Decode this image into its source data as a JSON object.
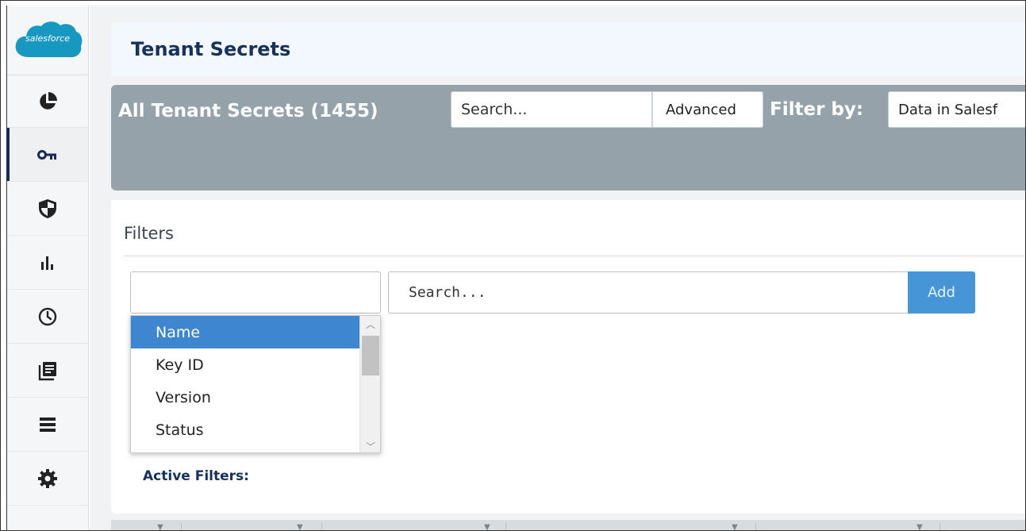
{
  "brand": {
    "logo_text": "salesforce",
    "logo_color": "#1798c1"
  },
  "sidebar": {
    "items": [
      {
        "icon": "pie-chart-icon",
        "active": false
      },
      {
        "icon": "key-icon",
        "active": true
      },
      {
        "icon": "shield-icon",
        "active": false
      },
      {
        "icon": "bar-chart-icon",
        "active": false
      },
      {
        "icon": "clock-icon",
        "active": false
      },
      {
        "icon": "document-list-icon",
        "active": false
      },
      {
        "icon": "server-list-icon",
        "active": false
      },
      {
        "icon": "gear-icon",
        "active": false
      }
    ]
  },
  "header": {
    "title": "Tenant Secrets"
  },
  "toolbar": {
    "title": "All Tenant Secrets (1455)",
    "search_placeholder": "Search...",
    "advanced_label": "Advanced",
    "filter_label": "Filter by:",
    "filter_value": "Data in Salesf"
  },
  "filters": {
    "heading": "Filters",
    "search_placeholder": "Search...",
    "add_label": "Add",
    "field_options": [
      "Name",
      "Key ID",
      "Version",
      "Status"
    ],
    "selected_option": "Name",
    "active_filters_label": "Active Filters:"
  },
  "colors": {
    "accent": "#4695d6",
    "toolbar_bg": "#95a2aa",
    "title_color": "#16325c",
    "selected_option_bg": "#3e87d0"
  }
}
